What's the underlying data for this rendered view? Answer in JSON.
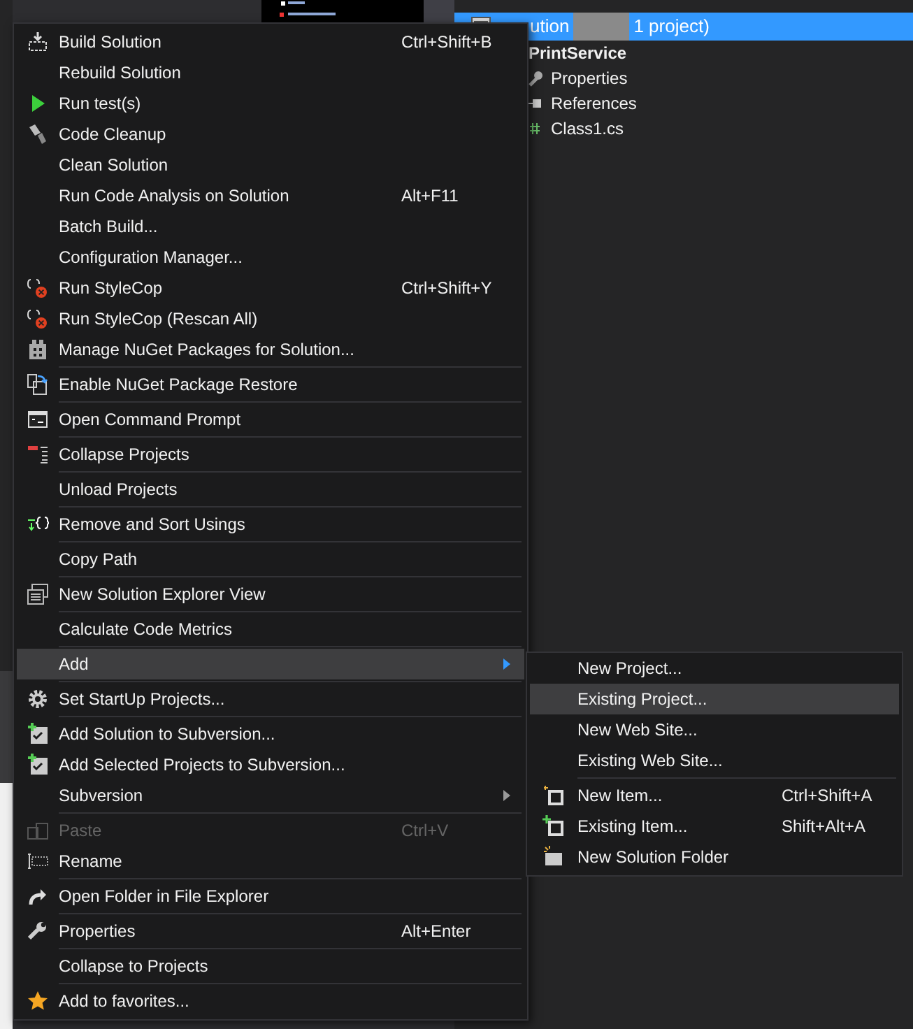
{
  "solution_explorer": {
    "solution_row": {
      "text_start": "ution",
      "text_end": "1 project)",
      "selected": true
    },
    "project": "PrintService",
    "items": [
      {
        "label": "Properties"
      },
      {
        "label": "References"
      },
      {
        "label": "Class1.cs"
      }
    ]
  },
  "context_menu": {
    "groups": [
      [
        {
          "label": "Build Solution",
          "shortcut": "Ctrl+Shift+B"
        },
        {
          "label": "Rebuild Solution"
        },
        {
          "label": "Run test(s)"
        },
        {
          "label": "Code Cleanup"
        },
        {
          "label": "Clean Solution"
        },
        {
          "label": "Run Code Analysis on Solution",
          "shortcut": "Alt+F11"
        },
        {
          "label": "Batch Build..."
        },
        {
          "label": "Configuration Manager..."
        },
        {
          "label": "Run StyleCop",
          "shortcut": "Ctrl+Shift+Y"
        },
        {
          "label": "Run StyleCop (Rescan All)"
        },
        {
          "label": "Manage NuGet Packages for Solution..."
        }
      ],
      [
        {
          "label": "Enable NuGet Package Restore"
        }
      ],
      [
        {
          "label": "Open Command Prompt"
        }
      ],
      [
        {
          "label": "Collapse Projects"
        }
      ],
      [
        {
          "label": "Unload Projects"
        }
      ],
      [
        {
          "label": "Remove and Sort Usings"
        }
      ],
      [
        {
          "label": "Copy Path"
        }
      ],
      [
        {
          "label": "New Solution Explorer View"
        }
      ],
      [
        {
          "label": "Calculate Code Metrics"
        }
      ],
      [
        {
          "label": "Add",
          "submenu": true,
          "selected": true
        }
      ],
      [
        {
          "label": "Set StartUp Projects..."
        }
      ],
      [
        {
          "label": "Add Solution to Subversion..."
        },
        {
          "label": "Add Selected Projects to Subversion..."
        },
        {
          "label": "Subversion",
          "submenu": true
        }
      ],
      [
        {
          "label": "Paste",
          "shortcut": "Ctrl+V",
          "disabled": true
        },
        {
          "label": "Rename"
        }
      ],
      [
        {
          "label": "Open Folder in File Explorer"
        }
      ],
      [
        {
          "label": "Properties",
          "shortcut": "Alt+Enter"
        }
      ],
      [
        {
          "label": "Collapse to Projects"
        }
      ],
      [
        {
          "label": "Add to favorites..."
        }
      ]
    ]
  },
  "add_submenu": {
    "groups": [
      [
        {
          "label": "New Project..."
        },
        {
          "label": "Existing Project...",
          "selected": true
        },
        {
          "label": "New Web Site..."
        },
        {
          "label": "Existing Web Site..."
        }
      ],
      [
        {
          "label": "New Item...",
          "shortcut": "Ctrl+Shift+A"
        },
        {
          "label": "Existing Item...",
          "shortcut": "Shift+Alt+A"
        },
        {
          "label": "New Solution Folder"
        }
      ]
    ]
  }
}
